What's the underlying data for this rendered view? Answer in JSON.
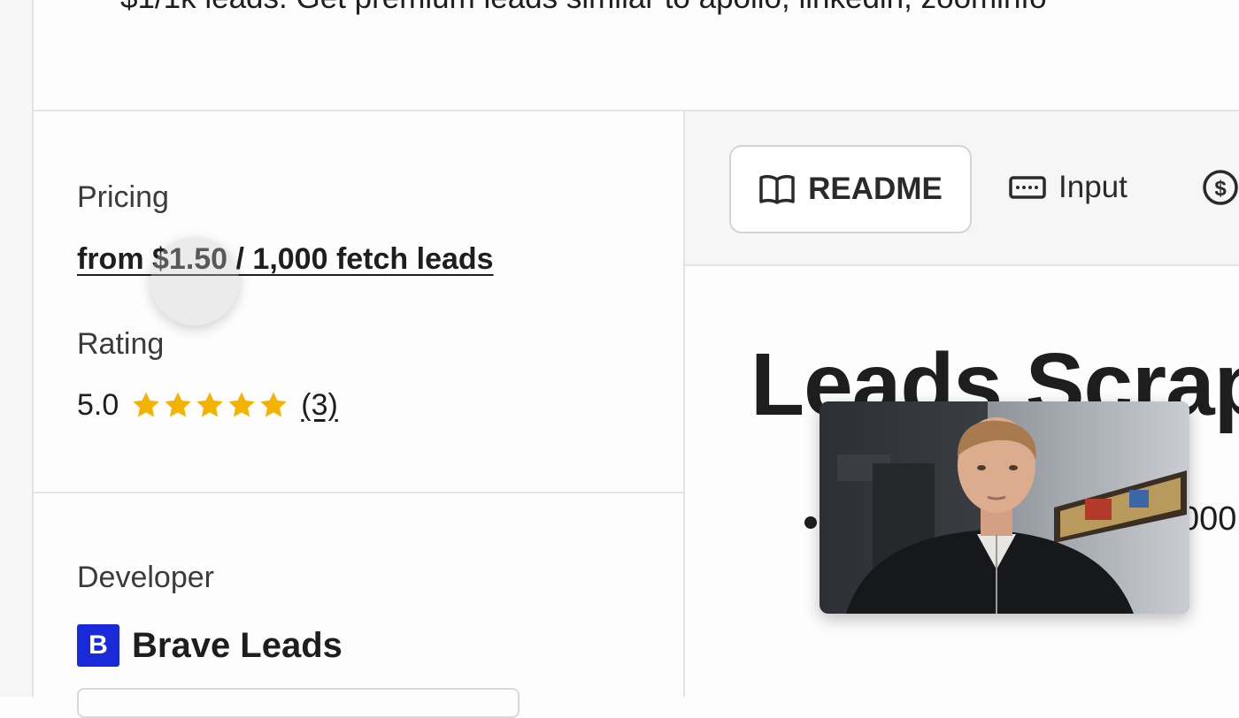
{
  "page": {
    "description_text": "$1/1k leads. Get premium leads similar to apollo, linkedin, zoominfo"
  },
  "sidebar": {
    "pricing": {
      "label": "Pricing",
      "price_text": "from $1.50 / 1,000 fetch leads"
    },
    "rating": {
      "label": "Rating",
      "value": "5.0",
      "stars": 5,
      "count_text": "(3)"
    },
    "developer": {
      "label": "Developer",
      "logo_letter": "B",
      "name": "Brave Leads",
      "logo_color": "#1a2ad8"
    }
  },
  "tabs": [
    {
      "label": "README",
      "icon": "book-icon",
      "active": true
    },
    {
      "label": "Input",
      "icon": "keyboard-icon",
      "active": false
    },
    {
      "label": "",
      "icon": "dollar-circle-icon",
      "active": false
    }
  ],
  "readme": {
    "heading": "Leads Scrap",
    "bullet_partial": "000"
  },
  "overlay": {
    "type": "webcam-video"
  },
  "colors": {
    "star": "#f5b301",
    "border": "#e3e3e3",
    "text": "#1e1e1e"
  }
}
